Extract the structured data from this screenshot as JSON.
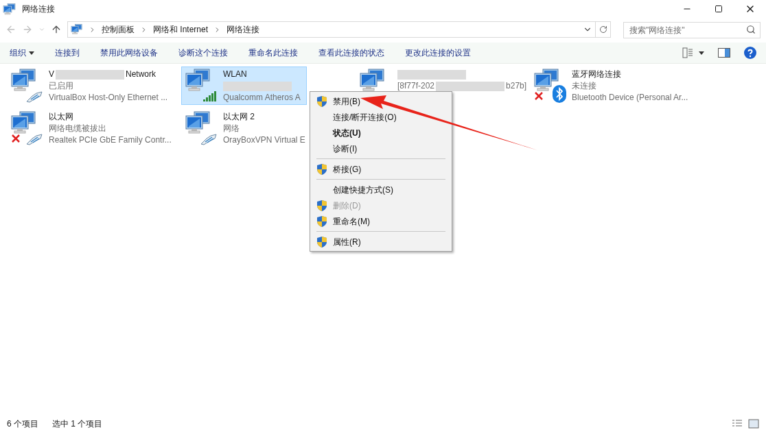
{
  "window": {
    "title": "网络连接"
  },
  "address_bar": {
    "breadcrumbs": [
      "控制面板",
      "网络和 Internet",
      "网络连接"
    ]
  },
  "search": {
    "placeholder": "搜索\"网络连接\""
  },
  "command_bar": {
    "organize": "组织",
    "commands": [
      "连接到",
      "禁用此网络设备",
      "诊断这个连接",
      "重命名此连接",
      "查看此连接的状态",
      "更改此连接的设置"
    ]
  },
  "connections": [
    {
      "selected": false,
      "kind": "cable",
      "error": false,
      "name": [
        {
          "kind": "text",
          "text": "V"
        },
        {
          "kind": "blur"
        },
        {
          "kind": "text",
          "text": "Network"
        }
      ],
      "status": [
        {
          "kind": "text",
          "text": "已启用"
        }
      ],
      "device": "VirtualBox Host-Only Ethernet ..."
    },
    {
      "selected": true,
      "kind": "wifi",
      "error": false,
      "name": [
        {
          "kind": "text",
          "text": "WLAN"
        }
      ],
      "status": [
        {
          "kind": "blur"
        }
      ],
      "device": "Qualcomm Atheros A"
    },
    {
      "selected": false,
      "kind": "plain",
      "error": false,
      "name": [
        {
          "kind": "blur"
        }
      ],
      "status": [
        {
          "kind": "text",
          "text": "[8f77f-202"
        },
        {
          "kind": "blur"
        },
        {
          "kind": "text",
          "text": "b27b]"
        }
      ]
    },
    {
      "selected": false,
      "kind": "bluetooth",
      "error": true,
      "name": [
        {
          "kind": "text",
          "text": "蓝牙网络连接"
        }
      ],
      "status": [
        {
          "kind": "text",
          "text": "未连接"
        }
      ],
      "device": "Bluetooth Device (Personal Ar..."
    },
    {
      "selected": false,
      "kind": "cable",
      "error": true,
      "name": [
        {
          "kind": "text",
          "text": "以太网"
        }
      ],
      "status": [
        {
          "kind": "text",
          "text": "网络电缆被拔出"
        }
      ],
      "device": "Realtek PCIe GbE Family Contr..."
    },
    {
      "selected": false,
      "kind": "cable",
      "error": false,
      "name": [
        {
          "kind": "text",
          "text": "以太网 2"
        }
      ],
      "status": [
        {
          "kind": "text",
          "text": "网络"
        }
      ],
      "device": "OrayBoxVPN Virtual E"
    }
  ],
  "context_menu": [
    {
      "kind": "item",
      "label": "禁用(B)",
      "shield": true,
      "bold": false,
      "disabled": false
    },
    {
      "kind": "item",
      "label": "连接/断开连接(O)",
      "shield": false,
      "bold": false,
      "disabled": false
    },
    {
      "kind": "item",
      "label": "状态(U)",
      "shield": false,
      "bold": true,
      "disabled": false
    },
    {
      "kind": "item",
      "label": "诊断(I)",
      "shield": false,
      "bold": false,
      "disabled": false
    },
    {
      "kind": "separator"
    },
    {
      "kind": "item",
      "label": "桥接(G)",
      "shield": true,
      "bold": false,
      "disabled": false
    },
    {
      "kind": "separator"
    },
    {
      "kind": "item",
      "label": "创建快捷方式(S)",
      "shield": false,
      "bold": false,
      "disabled": false
    },
    {
      "kind": "item",
      "label": "删除(D)",
      "shield": true,
      "bold": false,
      "disabled": true
    },
    {
      "kind": "item",
      "label": "重命名(M)",
      "shield": true,
      "bold": false,
      "disabled": false
    },
    {
      "kind": "separator"
    },
    {
      "kind": "item",
      "label": "属性(R)",
      "shield": true,
      "bold": false,
      "disabled": false
    }
  ],
  "status_bar": {
    "count": "6 个项目",
    "selection": "选中 1 个项目"
  }
}
